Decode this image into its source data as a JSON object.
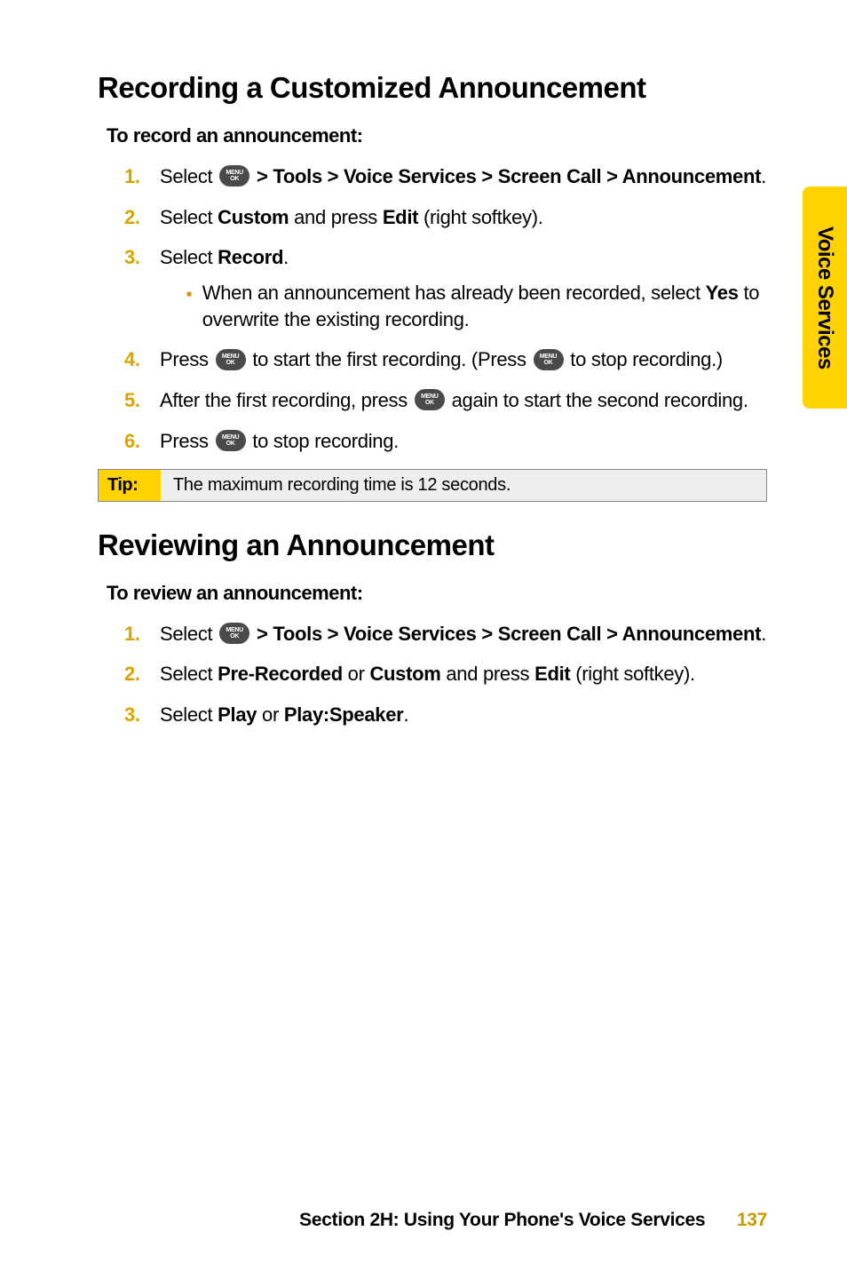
{
  "sideTab": "Voice Services",
  "section1": {
    "heading": "Recording a Customized Announcement",
    "sub": "To record an announcement:",
    "steps": [
      {
        "num": "1.",
        "pre": "Select ",
        "boldPath": " > Tools > Voice Services > Screen Call > Announcement",
        "post": "."
      },
      {
        "num": "2.",
        "t1": "Select ",
        "b1": "Custom",
        "t2": " and press ",
        "b2": "Edit",
        "t3": " (right softkey)."
      },
      {
        "num": "3.",
        "t1": "Select ",
        "b1": "Record",
        "t2": ".",
        "bullet_t1": "When an announcement has already been recorded, select ",
        "bullet_b1": "Yes",
        "bullet_t2": " to overwrite the existing recording."
      },
      {
        "num": "4.",
        "t1": "Press ",
        "t2": " to start the first recording. (Press ",
        "t3": " to stop recording.)"
      },
      {
        "num": "5.",
        "t1": "After the first recording, press ",
        "t2": " again to start the second recording."
      },
      {
        "num": "6.",
        "t1": "Press ",
        "t2": " to stop recording."
      }
    ]
  },
  "tip": {
    "label": "Tip:",
    "text": "The maximum recording time is 12 seconds."
  },
  "section2": {
    "heading": "Reviewing an Announcement",
    "sub": "To review an announcement:",
    "steps": [
      {
        "num": "1.",
        "pre": "Select ",
        "boldPath": " > Tools > Voice Services > Screen Call > Announcement",
        "post": "."
      },
      {
        "num": "2.",
        "t1": "Select ",
        "b1": "Pre-Recorded",
        "t2": " or ",
        "b2": "Custom",
        "t3": " and press ",
        "b3": "Edit",
        "t4": " (right softkey)."
      },
      {
        "num": "3.",
        "t1": "Select ",
        "b1": "Play",
        "t2": " or ",
        "b2": "Play:Speaker",
        "t3": "."
      }
    ]
  },
  "menuIcon": {
    "line1": "MENU",
    "line2": "OK"
  },
  "footer": {
    "text": "Section 2H: Using Your Phone's Voice Services",
    "page": "137"
  }
}
